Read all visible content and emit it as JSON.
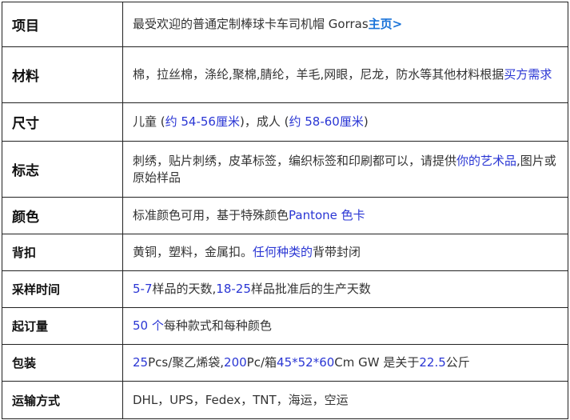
{
  "rows": [
    {
      "label": "项目",
      "size": 17,
      "h": 56,
      "segments": [
        {
          "text": "最受欢迎的普通定制棒球卡车司机帽 Gorras",
          "style": "plain"
        },
        {
          "text": "主页>",
          "style": "home"
        }
      ]
    },
    {
      "label": "材料",
      "size": 17,
      "h": 70,
      "segments": [
        {
          "text": "棉，拉丝棉，涤纶,聚棉,腈纶，羊毛,网眼，尼龙，防水等其他材料根据",
          "style": "plain"
        },
        {
          "text": "买方需求",
          "style": "link"
        }
      ]
    },
    {
      "label": "尺寸",
      "size": 17,
      "h": 48,
      "segments": [
        {
          "text": "儿童 (",
          "style": "plain"
        },
        {
          "text": "约 54-56厘米",
          "style": "link"
        },
        {
          "text": ")，成人 (",
          "style": "plain"
        },
        {
          "text": "约 58-60厘米",
          "style": "link"
        },
        {
          "text": ")",
          "style": "plain"
        }
      ]
    },
    {
      "label": "标志",
      "size": 17,
      "h": 70,
      "segments": [
        {
          "text": "刺绣，贴片刺绣，皮革标签，编织标签和印刷都可以，请提供",
          "style": "plain"
        },
        {
          "text": "你的艺术品",
          "style": "link"
        },
        {
          "text": ",图片或原始样品",
          "style": "plain"
        }
      ]
    },
    {
      "label": "颜色",
      "size": 17,
      "h": 46,
      "segments": [
        {
          "text": "标准颜色可用，基于特殊颜色",
          "style": "plain"
        },
        {
          "text": "Pantone 色卡",
          "style": "link"
        }
      ]
    },
    {
      "label": "背扣",
      "size": 15,
      "h": 46,
      "segments": [
        {
          "text": "黄铜，塑料，金属扣。",
          "style": "plain"
        },
        {
          "text": "任何种类的",
          "style": "link"
        },
        {
          "text": "背带封闭",
          "style": "plain"
        }
      ]
    },
    {
      "label": "采样时间",
      "size": 15,
      "h": 46,
      "segments": [
        {
          "text": "5-7",
          "style": "link"
        },
        {
          "text": "样品的天数,",
          "style": "plain"
        },
        {
          "text": "18-25",
          "style": "link"
        },
        {
          "text": "样品批准后的生产天数",
          "style": "plain"
        }
      ]
    },
    {
      "label": "起订量",
      "size": 15,
      "h": 46,
      "segments": [
        {
          "text": "50 个",
          "style": "link"
        },
        {
          "text": "每种款式和每种颜色",
          "style": "plain"
        }
      ]
    },
    {
      "label": "包装",
      "size": 15,
      "h": 46,
      "segments": [
        {
          "text": "25",
          "style": "link"
        },
        {
          "text": "Pcs/聚乙烯袋,",
          "style": "plain"
        },
        {
          "text": "200",
          "style": "link"
        },
        {
          "text": "Pc/箱",
          "style": "plain"
        },
        {
          "text": "45*52*60",
          "style": "link"
        },
        {
          "text": "Cm GW 是关于",
          "style": "plain"
        },
        {
          "text": "22.5",
          "style": "link"
        },
        {
          "text": "公斤",
          "style": "plain"
        }
      ]
    },
    {
      "label": "运输方式",
      "size": 15,
      "h": 47,
      "segments": [
        {
          "text": "DHL，UPS，Fedex，TNT，海运，空运",
          "style": "plain"
        }
      ]
    }
  ]
}
